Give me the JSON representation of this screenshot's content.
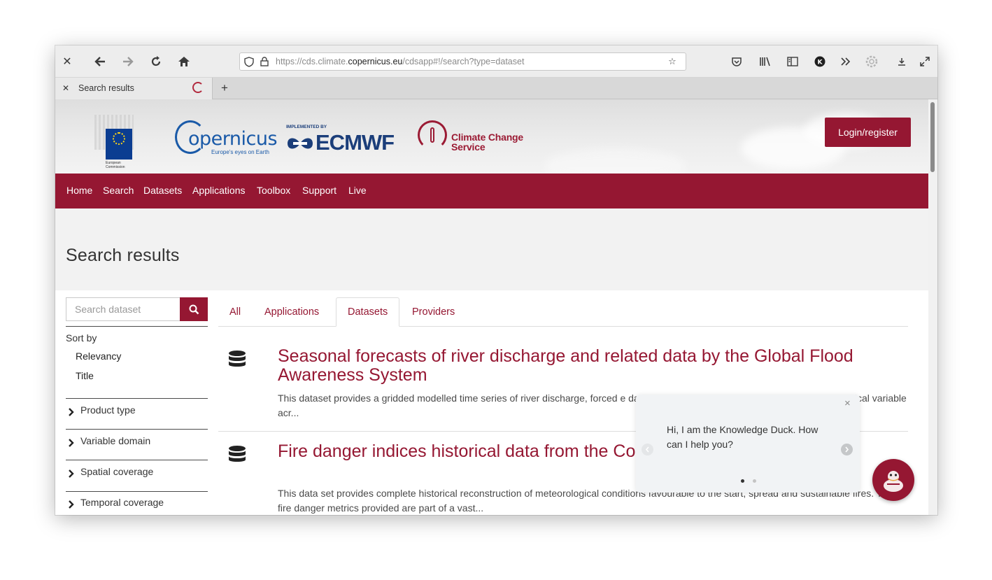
{
  "browser": {
    "url_host_prefix": "https://cds.climate.",
    "url_host_domain": "copernicus.eu",
    "url_path": "/cdsapp#!/search?type=dataset",
    "tab_title": "Search results",
    "new_tab_label": "+"
  },
  "header": {
    "ec_label": "European Commission",
    "copernicus_word": "opernicus",
    "copernicus_tagline": "Europe's eyes on Earth",
    "ecmwf_implemented_by": "IMPLEMENTED BY",
    "ecmwf_label": "ECMWF",
    "c3s_line1": "Climate Change",
    "c3s_line2": "Service",
    "login_label": "Login/register"
  },
  "nav": {
    "items": [
      "Home",
      "Search",
      "Datasets",
      "Applications",
      "Toolbox",
      "Support",
      "Live"
    ]
  },
  "page_title": "Search results",
  "sidebar": {
    "search_placeholder": "Search dataset",
    "sort_by_label": "Sort by",
    "sort_options": [
      "Relevancy",
      "Title"
    ],
    "filters": [
      "Product type",
      "Variable domain",
      "Spatial coverage",
      "Temporal coverage"
    ]
  },
  "tabs": [
    "All",
    "Applications",
    "Datasets",
    "Providers"
  ],
  "active_tab": "Datasets",
  "results": [
    {
      "title": "Seasonal forecasts of river discharge and related data by the Global Flood Awareness System",
      "description": "This dataset provides a gridded modelled time series of river discharge, forced                                                                                            e data is a consistent representation of a key hydrological variable acr..."
    },
    {
      "title": "Fire danger indices historical data from the Co                                          ement Service",
      "description": "This data set provides complete historical reconstruction of meteorological conditions favourable to the start, spread and sustainable fires. The fire danger metrics provided are part of a vast..."
    }
  ],
  "chat": {
    "message": "Hi, I am the Knowledge Duck. How can I help you?",
    "close_label": "×"
  },
  "colors": {
    "brand": "#951732",
    "nav_bg": "#951732",
    "hero_bg": "#f2f2f2"
  }
}
